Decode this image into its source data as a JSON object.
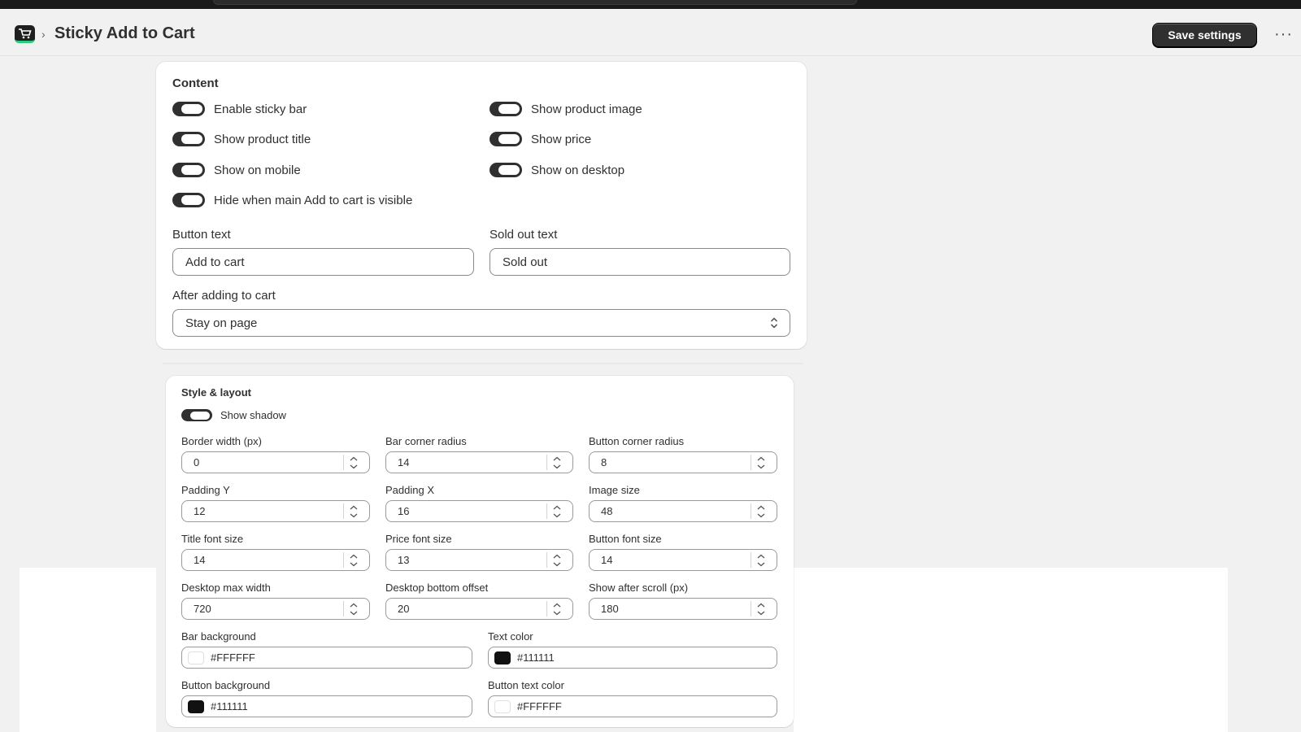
{
  "header": {
    "title": "Sticky Add to Cart",
    "breadcrumb_separator": "›",
    "save_label": "Save settings",
    "more_label": "···"
  },
  "content": {
    "title": "Content",
    "toggles": [
      {
        "label": "Enable sticky bar",
        "on": true
      },
      {
        "label": "Show product image",
        "on": true
      },
      {
        "label": "Show product title",
        "on": true
      },
      {
        "label": "Show price",
        "on": true
      },
      {
        "label": "Show on mobile",
        "on": true
      },
      {
        "label": "Show on desktop",
        "on": true
      },
      {
        "label": "Hide when main Add to cart is visible",
        "on": true
      }
    ],
    "button_text": {
      "label": "Button text",
      "value": "Add to cart"
    },
    "sold_out_text": {
      "label": "Sold out text",
      "value": "Sold out"
    },
    "after_adding": {
      "label": "After adding to cart",
      "value": "Stay on page"
    }
  },
  "style": {
    "title": "Style & layout",
    "show_shadow": {
      "label": "Show shadow",
      "on": true
    },
    "fields": [
      {
        "label": "Border width (px)",
        "value": "0"
      },
      {
        "label": "Bar corner radius",
        "value": "14"
      },
      {
        "label": "Button corner radius",
        "value": "8"
      },
      {
        "label": "Padding Y",
        "value": "12"
      },
      {
        "label": "Padding X",
        "value": "16"
      },
      {
        "label": "Image size",
        "value": "48"
      },
      {
        "label": "Title font size",
        "value": "14"
      },
      {
        "label": "Price font size",
        "value": "13"
      },
      {
        "label": "Button font size",
        "value": "14"
      },
      {
        "label": "Desktop max width",
        "value": "720"
      },
      {
        "label": "Desktop bottom offset",
        "value": "20"
      },
      {
        "label": "Show after scroll (px)",
        "value": "180"
      }
    ],
    "colors": [
      {
        "label": "Bar background",
        "value": "#FFFFFF",
        "swatch": "#FFFFFF"
      },
      {
        "label": "Text color",
        "value": "#111111",
        "swatch": "#111111"
      },
      {
        "label": "Button background",
        "value": "#111111",
        "swatch": "#111111"
      },
      {
        "label": "Button text color",
        "value": "#FFFFFF",
        "swatch": "#FFFFFF"
      }
    ]
  },
  "colors": {
    "toggle_on": "#303030",
    "primary_button": "#303030",
    "app_icon_accent": "#2ec97a"
  }
}
